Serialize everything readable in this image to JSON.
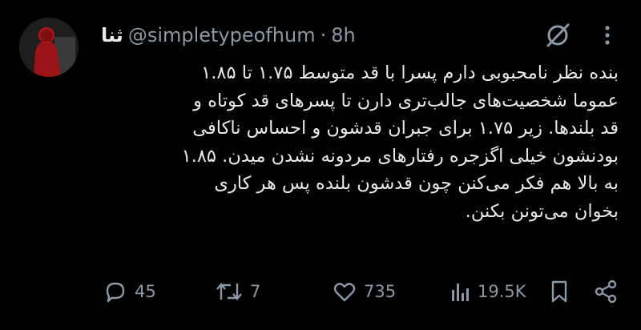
{
  "tweet": {
    "display_name": "ثنا",
    "handle": "@simpletypeofhum",
    "separator": "·",
    "time": "8h",
    "text": "بنده نظر نامحبوبی دارم پسرا با قد متوسط ۱.۷۵ تا ۱.۸۵\nعموما شخصیت‌های جالب‌تری دارن تا پسرهای قد کوتاه و\nقد بلندها. زیر ۱.۷۵ برای جبران قدشون و احساس ناکافی\nبودنشون خیلی اگزجره رفتارهای مردونه نشدن میدن. ۱.۸۵\nبه بالا هم فکر می‌کنن چون قدشون بلنده پس هر کاری\nبخوان می‌تونن بکنن."
  },
  "actions": {
    "replies": "45",
    "reposts": "7",
    "likes": "735",
    "views": "19.5K"
  },
  "icons": {
    "reply": "reply-icon",
    "repost": "repost-icon",
    "like": "heart-icon",
    "views": "views-icon",
    "bookmark": "bookmark-icon",
    "share": "share-icon",
    "grok": "grok-icon",
    "more": "more-icon"
  },
  "colors": {
    "background": "#000000",
    "text": "#e7e9ea",
    "muted": "#8b98a5"
  }
}
